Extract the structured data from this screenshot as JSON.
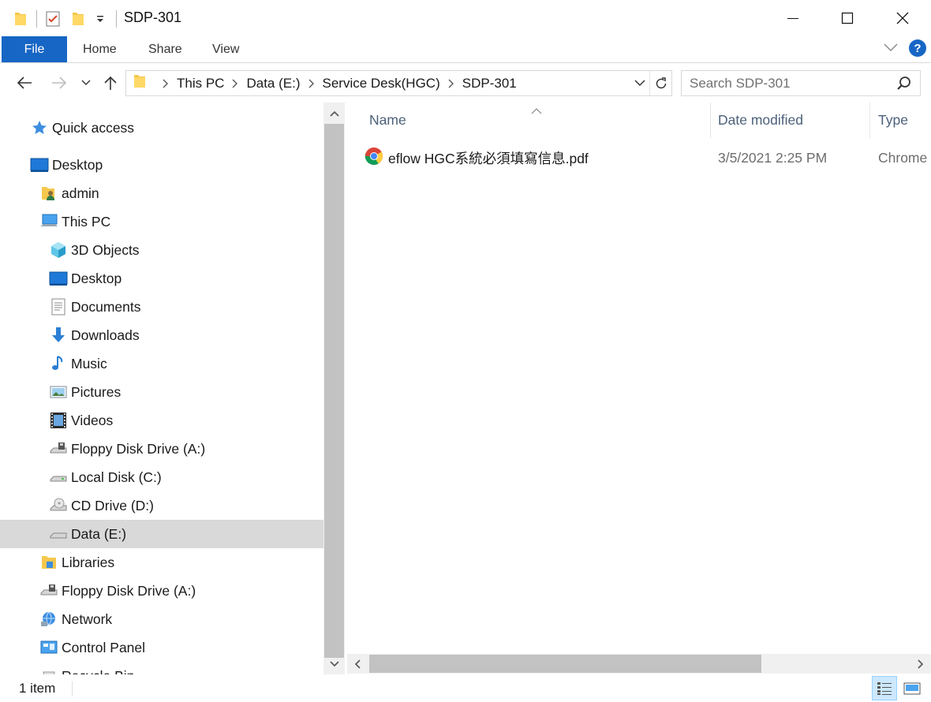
{
  "window": {
    "title": "SDP-301"
  },
  "ribbon": {
    "tabs": [
      {
        "label": "File"
      },
      {
        "label": "Home"
      },
      {
        "label": "Share"
      },
      {
        "label": "View"
      }
    ],
    "help_label": "?"
  },
  "address": {
    "breadcrumbs": [
      "This PC",
      "Data (E:)",
      "Service Desk(HGC)",
      "SDP-301"
    ]
  },
  "search": {
    "placeholder": "Search SDP-301"
  },
  "nav_pane": {
    "items": [
      {
        "label": "Quick access",
        "icon": "quick-access-star-icon"
      },
      {
        "label": "Desktop",
        "icon": "desktop-icon"
      },
      {
        "label": "admin",
        "icon": "user-folder-icon"
      },
      {
        "label": "This PC",
        "icon": "this-pc-icon"
      },
      {
        "label": "3D Objects",
        "icon": "3d-objects-icon"
      },
      {
        "label": "Desktop",
        "icon": "desktop-icon"
      },
      {
        "label": "Documents",
        "icon": "documents-icon"
      },
      {
        "label": "Downloads",
        "icon": "downloads-icon"
      },
      {
        "label": "Music",
        "icon": "music-icon"
      },
      {
        "label": "Pictures",
        "icon": "pictures-icon"
      },
      {
        "label": "Videos",
        "icon": "videos-icon"
      },
      {
        "label": "Floppy Disk Drive (A:)",
        "icon": "floppy-drive-icon"
      },
      {
        "label": "Local Disk (C:)",
        "icon": "local-disk-icon"
      },
      {
        "label": "CD Drive (D:)",
        "icon": "cd-drive-icon"
      },
      {
        "label": "Data (E:)",
        "icon": "data-drive-icon",
        "selected": true
      },
      {
        "label": "Libraries",
        "icon": "libraries-icon"
      },
      {
        "label": "Floppy Disk Drive (A:)",
        "icon": "floppy-drive-icon"
      },
      {
        "label": "Network",
        "icon": "network-icon"
      },
      {
        "label": "Control Panel",
        "icon": "control-panel-icon"
      },
      {
        "label": "Recycle Bin",
        "icon": "recycle-bin-icon"
      }
    ]
  },
  "file_list": {
    "columns": [
      "Name",
      "Date modified",
      "Type"
    ],
    "rows": [
      {
        "name": "eflow HGC系統必須填寫信息.pdf",
        "date_modified": "3/5/2021 2:25 PM",
        "type": "Chrome",
        "icon": "chrome-icon"
      }
    ]
  },
  "status": {
    "item_count": "1 item"
  },
  "colors": {
    "accent": "#1766c5",
    "selection": "#d9d9d9",
    "column_header": "#4c607a"
  }
}
